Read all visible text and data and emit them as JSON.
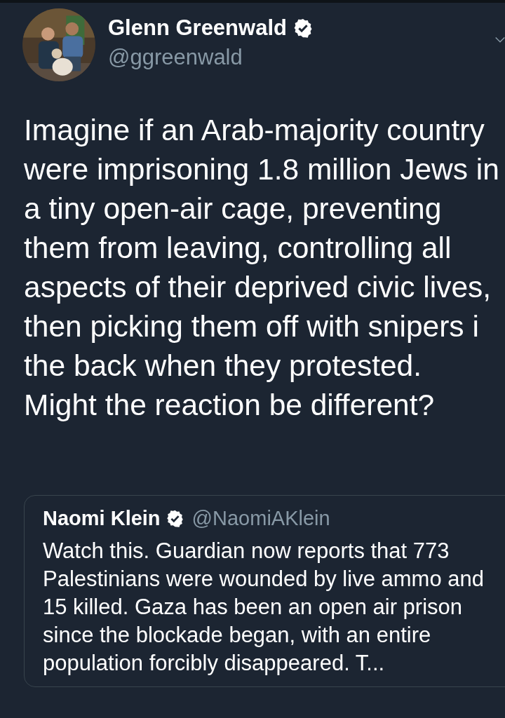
{
  "author": {
    "name": "Glenn Greenwald",
    "verified": true,
    "handle": "@ggreenwald"
  },
  "text_lines": [
    "Imagine if an Arab-majority country",
    "were imprisoning 1.8 million Jews in",
    "a tiny open-air cage, preventing",
    "them from leaving, controlling all",
    "aspects of their deprived civic lives,",
    "then picking them off with snipers i",
    "the back when they protested.",
    "Might the reaction be different?"
  ],
  "quoted_tweet": {
    "name": "Naomi Klein",
    "verified": true,
    "handle": "@NaomiAKlein",
    "text": "Watch this. Guardian now reports that 773 Palestinians were wounded by live ammo and 15 killed. Gaza has been an open air prison since the blockade began, with an entire population forcibly disappeared. T..."
  }
}
